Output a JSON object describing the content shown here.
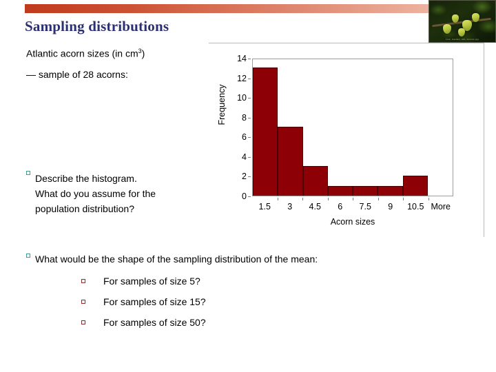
{
  "slide": {
    "title": "Sampling distributions",
    "accent_gradient_from": "#c03a1c",
    "accent_gradient_to": "#f2c4b4",
    "title_color": "#2b3070"
  },
  "photo": {
    "caption": "Live, Garden, Hill, Acorns.jpg",
    "alt_name": "acorns-on-branch-photo"
  },
  "body": {
    "lead_line_1_prefix": "Atlantic acorn sizes (in cm",
    "lead_line_1_sup": "3",
    "lead_line_1_suffix": ")",
    "lead_line_2": "— sample of 28 acorns:",
    "bullet_describe_line_1": "Describe the histogram.",
    "bullet_describe_line_2": "What do you assume for the",
    "bullet_describe_line_3": "population distribution?",
    "bullet_shape": "What would be the shape of the sampling distribution of the mean:",
    "sub_bullets": [
      "For samples of size 5?",
      "For samples of size 15?",
      "For samples of size 50?"
    ],
    "bullet_color_level1": "#3a9b8a",
    "bullet_color_level2": "#8e2b2b"
  },
  "chart_data": {
    "type": "bar",
    "title": "",
    "categories": [
      "1.5",
      "3",
      "4.5",
      "6",
      "7.5",
      "9",
      "10.5",
      "More"
    ],
    "values": [
      13,
      7,
      3,
      1,
      1,
      1,
      2,
      0
    ],
    "series": [
      {
        "name": "Frequency",
        "values": [
          13,
          7,
          3,
          1,
          1,
          1,
          2,
          0
        ]
      }
    ],
    "xlabel": "Acorn sizes",
    "ylabel": "Frequency",
    "ylim": [
      0,
      14
    ],
    "yticks": [
      0,
      2,
      4,
      6,
      8,
      10,
      12,
      14
    ],
    "grid": false,
    "legend": false,
    "bar_color": "#8c0006",
    "bar_border_color": "#4a0003"
  }
}
